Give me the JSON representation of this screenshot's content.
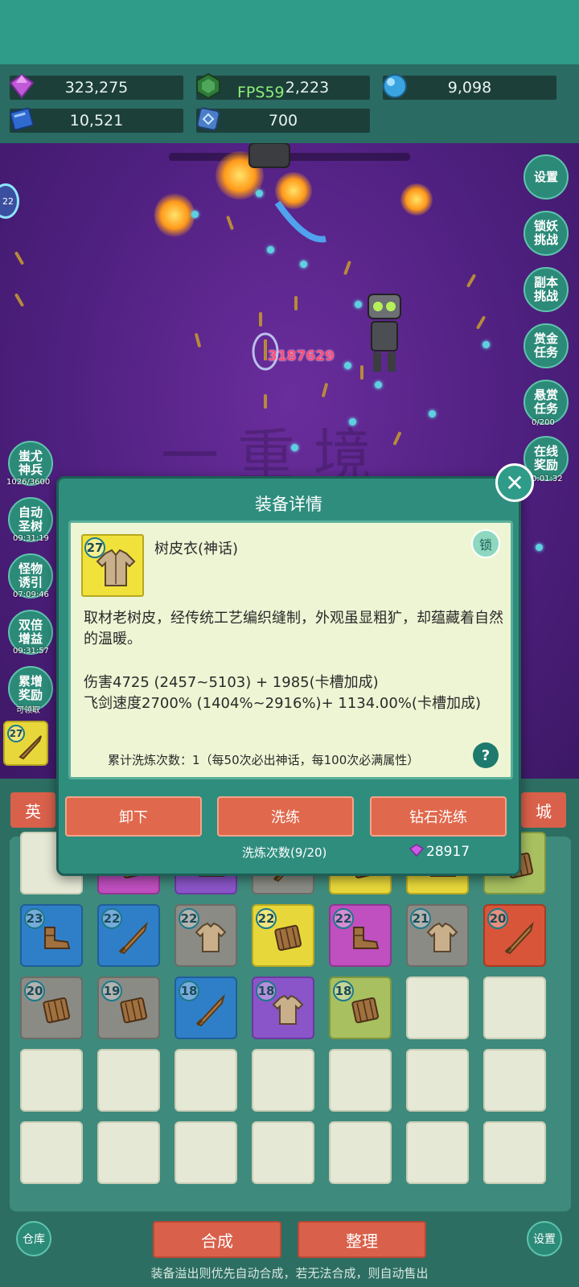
{
  "resources": {
    "gem": "323,275",
    "jade": "2,223",
    "orb": "9,098",
    "book": "10,521",
    "rune": "700"
  },
  "fps": "FPS59",
  "battle": {
    "damage": "3187629",
    "level_badge": "22"
  },
  "right_buttons": [
    {
      "label": "设置",
      "sub": ""
    },
    {
      "label": "锁妖\n挑战",
      "sub": ""
    },
    {
      "label": "副本\n挑战",
      "sub": ""
    },
    {
      "label": "赏金\n任务",
      "sub": ""
    },
    {
      "label": "悬赏\n任务",
      "sub": "0/200"
    },
    {
      "label": "在线\n奖励",
      "sub": "0:01:32"
    }
  ],
  "left_buttons": [
    {
      "label": "蚩尤\n神兵",
      "sub": "1026/3600"
    },
    {
      "label": "自动\n圣树",
      "sub": "09:31:19"
    },
    {
      "label": "怪物\n诱引",
      "sub": "07:09:46"
    },
    {
      "label": "双倍\n增益",
      "sub": "09:31:57"
    },
    {
      "label": "累增\n奖励",
      "sub": "可领取"
    }
  ],
  "quick_slot_level": "27",
  "tabs": {
    "left": "英",
    "right": "城"
  },
  "modal": {
    "title": "装备详情",
    "item_level": "27",
    "item_name": "树皮衣(神话)",
    "lock_label": "锁",
    "description": "取材老树皮，经传统工艺编织缝制，外观虽显粗犷，却蕴藏着自然的温暖。",
    "stat_damage": "伤害4725 (2457~5103) + 1985(卡槽加成)",
    "stat_speed": "飞剑速度2700% (1404%~2916%)+ 1134.00%(卡槽加成)",
    "refine_count": "累计洗炼次数：1（每50次必出神话，每100次必满属性）",
    "help": "?",
    "btn_unequip": "卸下",
    "btn_refine": "洗练",
    "btn_diamond_refine": "钻石洗练",
    "refine_times": "洗炼次数(9/20)",
    "diamond_cost": "28917",
    "close": "✕"
  },
  "inventory": [
    {
      "lvl": "",
      "color": "empty",
      "icon": ""
    },
    {
      "lvl": "",
      "color": "magenta",
      "icon": "armor"
    },
    {
      "lvl": "",
      "color": "purple",
      "icon": "boots"
    },
    {
      "lvl": "",
      "color": "gray",
      "icon": "sword"
    },
    {
      "lvl": "",
      "color": "yellow",
      "icon": "armor"
    },
    {
      "lvl": "",
      "color": "yellow",
      "icon": "boots"
    },
    {
      "lvl": "",
      "color": "olive",
      "icon": "armor"
    },
    {
      "lvl": "23",
      "color": "blue",
      "icon": "boots"
    },
    {
      "lvl": "22",
      "color": "blue",
      "icon": "sword"
    },
    {
      "lvl": "22",
      "color": "gray",
      "icon": "shirt"
    },
    {
      "lvl": "22",
      "color": "yellow",
      "icon": "armor"
    },
    {
      "lvl": "22",
      "color": "magenta",
      "icon": "boots"
    },
    {
      "lvl": "21",
      "color": "gray",
      "icon": "shirt"
    },
    {
      "lvl": "20",
      "color": "red",
      "icon": "sword"
    },
    {
      "lvl": "20",
      "color": "gray",
      "icon": "armor"
    },
    {
      "lvl": "19",
      "color": "gray",
      "icon": "armor"
    },
    {
      "lvl": "18",
      "color": "blue",
      "icon": "sword"
    },
    {
      "lvl": "18",
      "color": "purple",
      "icon": "shirt"
    },
    {
      "lvl": "18",
      "color": "olive",
      "icon": "armor"
    },
    {
      "lvl": "",
      "color": "empty",
      "icon": ""
    },
    {
      "lvl": "",
      "color": "empty",
      "icon": ""
    },
    {
      "lvl": "",
      "color": "empty",
      "icon": ""
    },
    {
      "lvl": "",
      "color": "empty",
      "icon": ""
    },
    {
      "lvl": "",
      "color": "empty",
      "icon": ""
    },
    {
      "lvl": "",
      "color": "empty",
      "icon": ""
    },
    {
      "lvl": "",
      "color": "empty",
      "icon": ""
    },
    {
      "lvl": "",
      "color": "empty",
      "icon": ""
    },
    {
      "lvl": "",
      "color": "empty",
      "icon": ""
    },
    {
      "lvl": "",
      "color": "empty",
      "icon": ""
    },
    {
      "lvl": "",
      "color": "empty",
      "icon": ""
    },
    {
      "lvl": "",
      "color": "empty",
      "icon": ""
    },
    {
      "lvl": "",
      "color": "empty",
      "icon": ""
    },
    {
      "lvl": "",
      "color": "empty",
      "icon": ""
    },
    {
      "lvl": "",
      "color": "empty",
      "icon": ""
    },
    {
      "lvl": "",
      "color": "empty",
      "icon": ""
    }
  ],
  "bottom": {
    "warehouse": "仓库",
    "combine": "合成",
    "organize": "整理",
    "settings": "设置",
    "note": "装备溢出则优先自动合成，若无法合成，则自动售出"
  }
}
